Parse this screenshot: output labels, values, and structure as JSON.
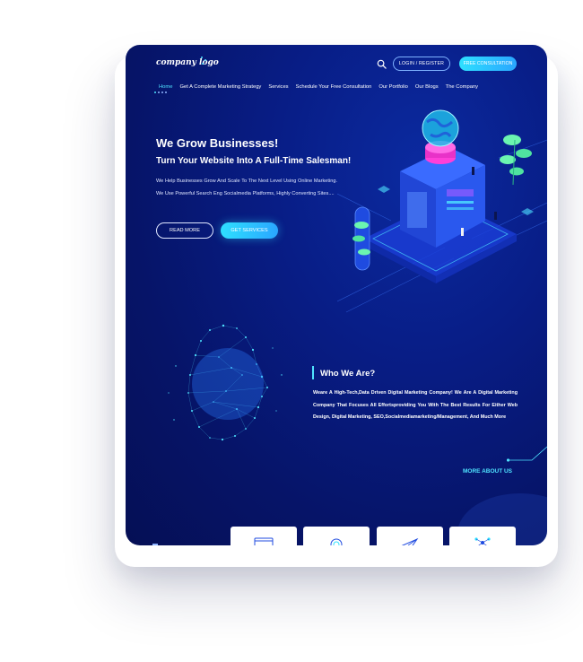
{
  "header": {
    "logo_text": "company logo",
    "login_label": "LOGIN / REGISTER",
    "consult_label": "FREE CONSULTATION"
  },
  "nav": {
    "items": [
      {
        "label": "Home",
        "active": true
      },
      {
        "label": "Get A Complete Marketing Strategy"
      },
      {
        "label": "Services"
      },
      {
        "label": "Schedule Your Free Consultation"
      },
      {
        "label": "Our Portfolio"
      },
      {
        "label": "Our Blogs"
      },
      {
        "label": "The Company"
      }
    ]
  },
  "hero": {
    "title": "We Grow Businesses!",
    "subtitle": "Turn Your Website Into A Full-Time Salesman!",
    "text": "We Help Businesses Grow And Scale To The Next Level Using Online Marketing. We Use Powerful Search Eng Socialmedia Platforms, Highly Converting Sites....",
    "read_more": "READ MORE",
    "get_services": "GET SERVICES"
  },
  "about": {
    "title": "Who We Are?",
    "text": "Weare A High-Tech,Data Driven Digital Marketing Company! We Are A Digital Marketing Company That Focuses All Effortsproviding You With The Best Results For Either Web Design, Digital Marketing, SEO,Socialmediamarketing/Management, And Much More",
    "more_label": "MORE ABOUT US"
  },
  "cards": [
    {
      "icon": "browser-icon"
    },
    {
      "icon": "seo-target-icon"
    },
    {
      "icon": "paper-plane-icon"
    },
    {
      "icon": "network-icon"
    }
  ],
  "colors": {
    "background": "#081d86",
    "accent": "#2ee0ff",
    "text": "#ffffff"
  }
}
